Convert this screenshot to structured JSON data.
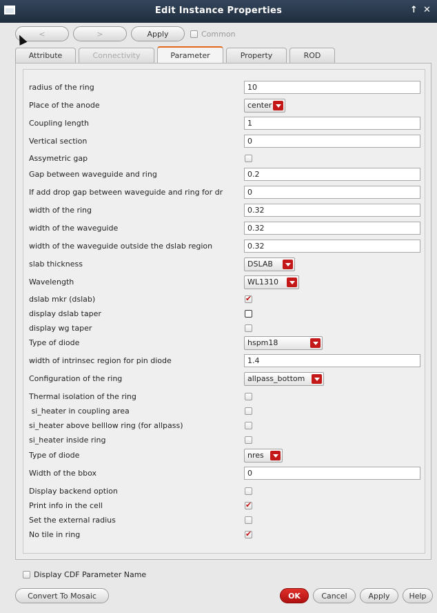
{
  "window": {
    "title": "Edit Instance Properties",
    "buttons": [
      "↑",
      "✕"
    ]
  },
  "toolbar": {
    "prev_label": "<",
    "next_label": ">",
    "apply_label": "Apply",
    "common_label": "Common"
  },
  "tabs": [
    {
      "label": "Attribute",
      "state": "normal"
    },
    {
      "label": "Connectivity",
      "state": "disabled"
    },
    {
      "label": "Parameter",
      "state": "active"
    },
    {
      "label": "Property",
      "state": "normal"
    },
    {
      "label": "ROD",
      "state": "normal"
    }
  ],
  "params": [
    {
      "label": "radius of the ring",
      "type": "text",
      "value": "10"
    },
    {
      "label": "Place of the anode",
      "type": "select",
      "value": "center"
    },
    {
      "label": "Coupling length",
      "type": "text",
      "value": "1"
    },
    {
      "label": "Vertical section",
      "type": "text",
      "value": "0"
    },
    {
      "label": "Assymetric gap",
      "type": "check",
      "checked": false
    },
    {
      "label": "Gap between waveguide and ring",
      "type": "text",
      "value": "0.2"
    },
    {
      "label": "If add drop gap between waveguide and ring for dr",
      "type": "text",
      "value": "0"
    },
    {
      "label": "width of the ring",
      "type": "text",
      "value": "0.32"
    },
    {
      "label": "width of the waveguide",
      "type": "text",
      "value": "0.32"
    },
    {
      "label": "width of the waveguide outside the dslab region",
      "type": "text",
      "value": "0.32"
    },
    {
      "label": "slab thickness",
      "type": "select",
      "value": "DSLAB"
    },
    {
      "label": "Wavelength",
      "type": "select",
      "value": "WL1310"
    },
    {
      "label": "dslab mkr (dslab)",
      "type": "check",
      "checked": true
    },
    {
      "label": "display dslab taper",
      "type": "check",
      "checked": false,
      "dark": true
    },
    {
      "label": "display wg taper",
      "type": "check",
      "checked": false
    },
    {
      "label": "Type of diode",
      "type": "select",
      "value": "hspm18"
    },
    {
      "label": "width of intrinsec region for pin diode",
      "type": "text",
      "value": "1.4"
    },
    {
      "label": "Configuration of the ring",
      "type": "select",
      "value": "allpass_bottom"
    },
    {
      "label": "Thermal isolation of the ring",
      "type": "check",
      "checked": false
    },
    {
      "label": " si_heater in coupling area",
      "type": "check",
      "checked": false
    },
    {
      "label": "si_heater above belllow ring (for allpass)",
      "type": "check",
      "checked": false
    },
    {
      "label": "si_heater inside ring",
      "type": "check",
      "checked": false
    },
    {
      "label": "Type of diode",
      "type": "select",
      "value": "nres"
    },
    {
      "label": "Width of the bbox",
      "type": "text",
      "value": "0"
    },
    {
      "label": "Display backend option",
      "type": "check",
      "checked": false
    },
    {
      "label": "Print info in the cell",
      "type": "check",
      "checked": true
    },
    {
      "label": "Set the external radius",
      "type": "check",
      "checked": false
    },
    {
      "label": "No tile in ring",
      "type": "check",
      "checked": true
    }
  ],
  "footer": {
    "display_cdf_label": "Display CDF Parameter Name",
    "convert_label": "Convert To Mosaic",
    "ok_label": "OK",
    "cancel_label": "Cancel",
    "apply_label": "Apply",
    "help_label": "Help"
  },
  "colors": {
    "accent": "#c41818",
    "titlebar": "#2a3a4e",
    "tab_active": "#e06a1a"
  }
}
